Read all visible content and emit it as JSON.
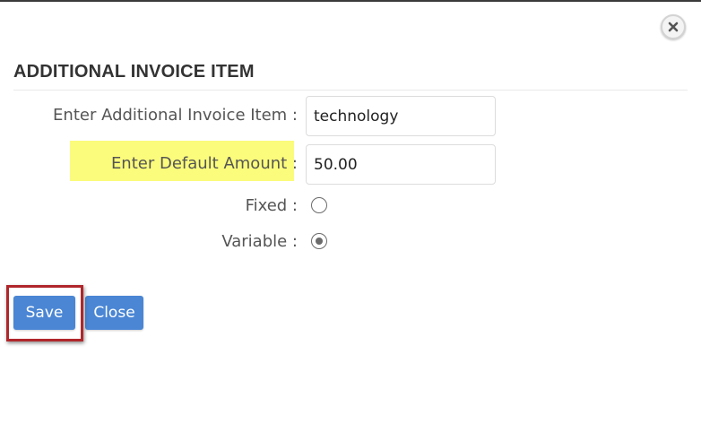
{
  "dialog": {
    "title": "ADDITIONAL INVOICE ITEM",
    "close_icon": "x-close-icon"
  },
  "form": {
    "item_label": "Enter Additional Invoice Item :",
    "item_value": "technology",
    "amount_label_text": "Enter Default Amount",
    "amount_label_colon": " :",
    "amount_value": "50.00",
    "fixed_label": "Fixed :",
    "fixed_selected": false,
    "variable_label": "Variable :",
    "variable_selected": true
  },
  "buttons": {
    "save_label": "Save",
    "close_label": "Close"
  },
  "colors": {
    "button_bg": "#4a86d4",
    "highlight": "#fbfb7c",
    "annotation_frame": "#b0262b"
  }
}
